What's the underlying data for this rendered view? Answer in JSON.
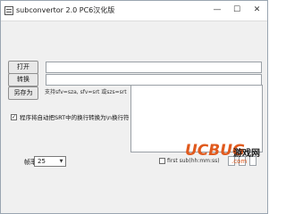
{
  "window": {
    "title": "subconvertor 2.0 PC6汉化版",
    "minimize_glyph": "—",
    "maximize_glyph": "☐",
    "close_glyph": "✕",
    "icon": "app-icon"
  },
  "buttons": {
    "open": "打开",
    "convert": "转换",
    "save_as": "另存为"
  },
  "fields": {
    "open_path": "",
    "convert_path": ""
  },
  "hint_text": "支持sfv=sza, sfv=srt 或szs=srt",
  "checkbox": {
    "label": "程序将自动把SRT中的换行转换为\\n换行符",
    "checked": true,
    "check_glyph": "✓"
  },
  "framerate": {
    "label": "帧率",
    "value": "25",
    "arrow_glyph": "▼"
  },
  "first_sub": {
    "label": "first sub(hh:mm:ss)",
    "checked": false
  },
  "watermark": {
    "letters": "UCBUG",
    "site_name": "游戏网",
    "url": ".com"
  },
  "colors": {
    "accent": "#e05a1e",
    "window_bg": "#f0f0f0",
    "button_bg": "#e8e8e8"
  }
}
